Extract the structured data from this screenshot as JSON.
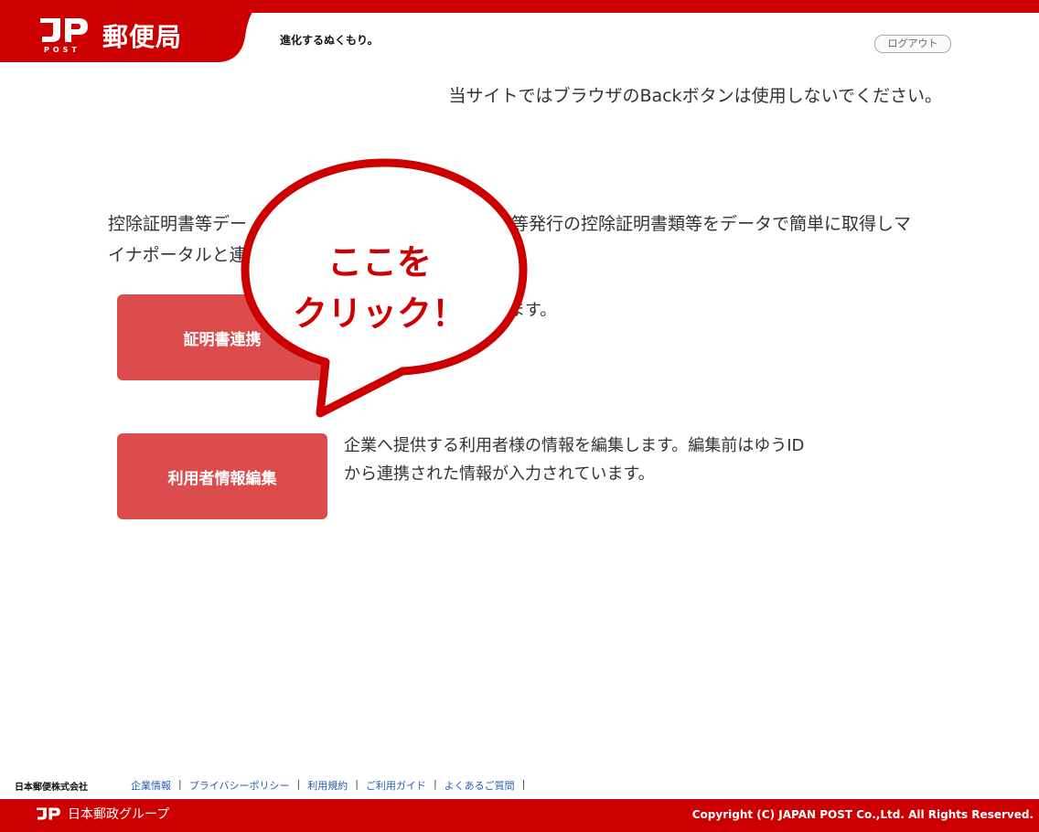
{
  "header": {
    "logo_text": "郵便局",
    "logo_mark": "JP",
    "logo_sub": "POST",
    "slogan": "進化するぬくもり。",
    "logout_label": "ログアウト"
  },
  "notice": "当サイトではブラウザのBackボタンは使用しないでください。",
  "description": "控除証明書等デー関等発行の控除証明書類等をデータで簡単に取得しマイナポータルと連",
  "description_visible": [
    "控除証明書等デー",
    "関等発行の控除証明書類等をデータで簡単に取得しマ",
    "イナポータルと連"
  ],
  "buttons": [
    {
      "label": "証明書連携",
      "desc": "選択及び連携申請をします。"
    },
    {
      "label": "利用者情報編集",
      "desc": "企業へ提供する利用者様の情報を編集します。編集前はゆうIDから連携された情報が入力されています。"
    }
  ],
  "callout": {
    "line1": "ここを",
    "line2": "クリック！",
    "color": "#cc0000"
  },
  "footer": {
    "company": "日本郵便株式会社",
    "links": [
      "企業情報",
      "プライバシーポリシー",
      "利用規約",
      "ご利用ガイド",
      "よくあるご質問"
    ],
    "group_logo": "日本郵政グループ",
    "copyright": "Copyright (C) JAPAN POST Co.,Ltd.  All Rights Reserved."
  },
  "colors": {
    "brand_red": "#cc0000",
    "button_red": "#dc4c4c",
    "link_blue": "#2a5db0"
  }
}
